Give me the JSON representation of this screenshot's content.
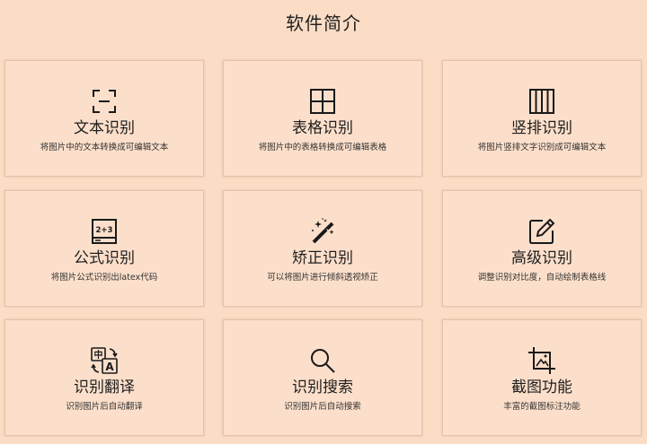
{
  "page": {
    "title": "软件简介"
  },
  "cards": [
    {
      "title": "文本识别",
      "desc": "将图片中的文本转换成可编辑文本",
      "icon": "text-scan-icon"
    },
    {
      "title": "表格识别",
      "desc": "将图片中的表格转换成可编辑表格",
      "icon": "table-grid-icon"
    },
    {
      "title": "竖排识别",
      "desc": "将图片竖排文字识别成可编辑文本",
      "icon": "vertical-columns-icon"
    },
    {
      "title": "公式识别",
      "desc": "将图片公式识别出latex代码",
      "icon": "formula-icon",
      "icon_text": "2+3"
    },
    {
      "title": "矫正识别",
      "desc": "可以将图片进行倾斜透视矫正",
      "icon": "magic-wand-icon"
    },
    {
      "title": "高级识别",
      "desc": "调整识别对比度，自动绘制表格线",
      "icon": "edit-pencil-icon"
    },
    {
      "title": "识别翻译",
      "desc": "识别图片后自动翻译",
      "icon": "translate-icon",
      "icon_text_zh": "中",
      "icon_text_en": "A"
    },
    {
      "title": "识别搜索",
      "desc": "识别图片后自动搜索",
      "icon": "search-icon"
    },
    {
      "title": "截图功能",
      "desc": "丰富的截图标注功能",
      "icon": "screenshot-crop-icon"
    }
  ],
  "colors": {
    "background": "#fbdcc5",
    "card_background": "#fcdfca",
    "card_border": "#e6c2a8",
    "text": "#1e1e1e"
  }
}
